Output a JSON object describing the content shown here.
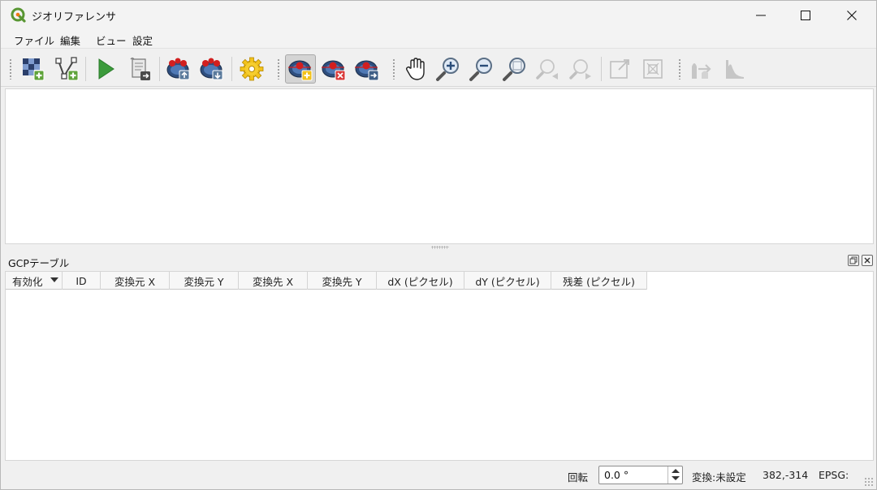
{
  "window": {
    "title": "ジオリファレンサ",
    "icon": "qgis-logo-icon"
  },
  "menu": [
    "ファイル",
    "編集",
    "ビュー",
    "設定"
  ],
  "toolbar": {
    "tools": [
      {
        "name": "open-raster-icon"
      },
      {
        "name": "start-georeferencing-icon"
      },
      {
        "name": "generate-gdal-script-icon"
      },
      {
        "name": "load-gcp-points-icon"
      },
      {
        "name": "save-gcp-points-icon"
      },
      {
        "name": "transformation-settings-icon"
      },
      {
        "name": "add-point-icon"
      },
      {
        "name": "delete-point-icon"
      },
      {
        "name": "move-gcp-point-icon"
      },
      {
        "name": "pan-icon"
      },
      {
        "name": "zoom-in-icon"
      },
      {
        "name": "zoom-out-icon"
      },
      {
        "name": "zoom-to-layer-icon"
      },
      {
        "name": "zoom-last-icon"
      },
      {
        "name": "zoom-next-icon"
      },
      {
        "name": "link-georeferencer-to-qgis-icon"
      },
      {
        "name": "link-qgis-to-georeferencer-icon"
      },
      {
        "name": "full-histogram-stretch-icon"
      },
      {
        "name": "local-histogram-stretch-icon"
      }
    ]
  },
  "gcp_table": {
    "title": "GCPテーブル",
    "columns": [
      "有効化",
      "ID",
      "変換元 X",
      "変換元 Y",
      "変換先 X",
      "変換先 Y",
      "dX (ピクセル)",
      "dY (ピクセル)",
      "残差 (ピクセル)"
    ],
    "rows": []
  },
  "status": {
    "rotation_label": "回転",
    "rotation_value": "0.0 °",
    "transform": "変換:未設定",
    "coords": "382,-314",
    "epsg": "EPSG:"
  }
}
